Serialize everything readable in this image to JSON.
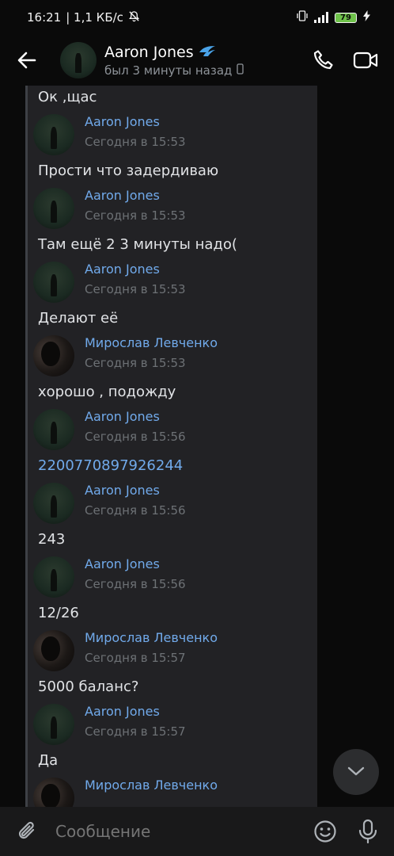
{
  "status_bar": {
    "time": "16:21",
    "speed": "| 1,1 КБ/с",
    "battery": "79"
  },
  "header": {
    "name": "Aaron Jones",
    "status": "был 3 минуты назад"
  },
  "messages": [
    {
      "text": "Ок ,щас"
    },
    {
      "author": "Aaron Jones",
      "time": "Сегодня в 15:53",
      "avatar": "photo-aaron",
      "text": "Прости что задердиваю"
    },
    {
      "author": "Aaron Jones",
      "time": "Сегодня в 15:53",
      "avatar": "photo-aaron",
      "text": "Там ещё 2 3 минуты надо("
    },
    {
      "author": "Aaron Jones",
      "time": "Сегодня в 15:53",
      "avatar": "photo-aaron",
      "text": "Делают её"
    },
    {
      "author": "Мирослав Левченко",
      "time": "Сегодня в 15:53",
      "avatar": "photo-miroslav",
      "text": "хорошо , подожду"
    },
    {
      "author": "Aaron Jones",
      "time": "Сегодня в 15:56",
      "avatar": "photo-aaron",
      "text": "2200770897926244"
    },
    {
      "author": "Aaron Jones",
      "time": "Сегодня в 15:56",
      "avatar": "photo-aaron",
      "text": "243"
    },
    {
      "author": "Aaron Jones",
      "time": "Сегодня в 15:56",
      "avatar": "photo-aaron",
      "text": "12/26"
    },
    {
      "author": "Мирослав Левченко",
      "time": "Сегодня в 15:57",
      "avatar": "photo-miroslav",
      "text": "5000 баланс?"
    },
    {
      "author": "Aaron Jones",
      "time": "Сегодня в 15:57",
      "avatar": "photo-aaron",
      "text": "Да"
    },
    {
      "author": "Мирослав Левченко",
      "time": "",
      "avatar": "photo-miroslav",
      "text": ""
    }
  ],
  "composer": {
    "placeholder": "Сообщение"
  },
  "icons": {
    "back": "arrow-left",
    "call": "phone",
    "video": "video-camera",
    "attach": "paperclip",
    "emoji": "smile",
    "voice": "microphone",
    "scroll": "chevron-down"
  },
  "colors": {
    "link": "#71aaeb",
    "battery": "#6ec24a"
  }
}
